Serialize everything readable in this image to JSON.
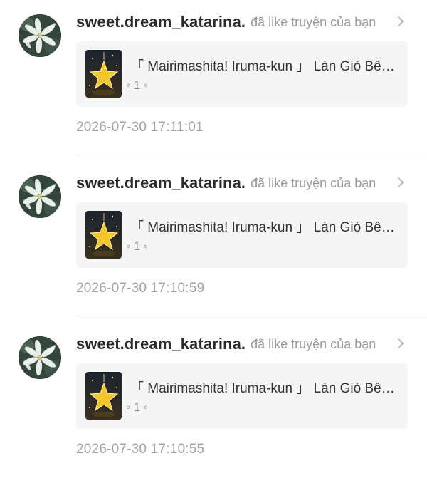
{
  "notifications": [
    {
      "username": "sweet.dream_katarina.",
      "action": "đã like truyện của bạn",
      "story_title": "「 Mairimashita! Iruma-kun 」 Làn Gió Bên Kia Sông",
      "story_meta": "◦ 1 ◦",
      "timestamp": "2026-07-30 17:11:01"
    },
    {
      "username": "sweet.dream_katarina.",
      "action": "đã like truyện của bạn",
      "story_title": "「 Mairimashita! Iruma-kun 」 Làn Gió Bên Kia Sông",
      "story_meta": "◦ 1 ◦",
      "timestamp": "2026-07-30 17:10:59"
    },
    {
      "username": "sweet.dream_katarina.",
      "action": "đã like truyện của bạn",
      "story_title": "「 Mairimashita! Iruma-kun 」 Làn Gió Bên Kia Sông",
      "story_meta": "◦ 1 ◦",
      "timestamp": "2026-07-30 17:10:55"
    }
  ],
  "icons": {
    "chevron": "chevron-right-icon",
    "avatar": "flower-avatar",
    "cover": "star-cover"
  },
  "colors": {
    "username": "#2b2b2b",
    "action": "#9a9a9a",
    "timestamp": "#a3a3a3",
    "card_bg": "#f5f5f5",
    "divider": "#e6e6e6"
  }
}
